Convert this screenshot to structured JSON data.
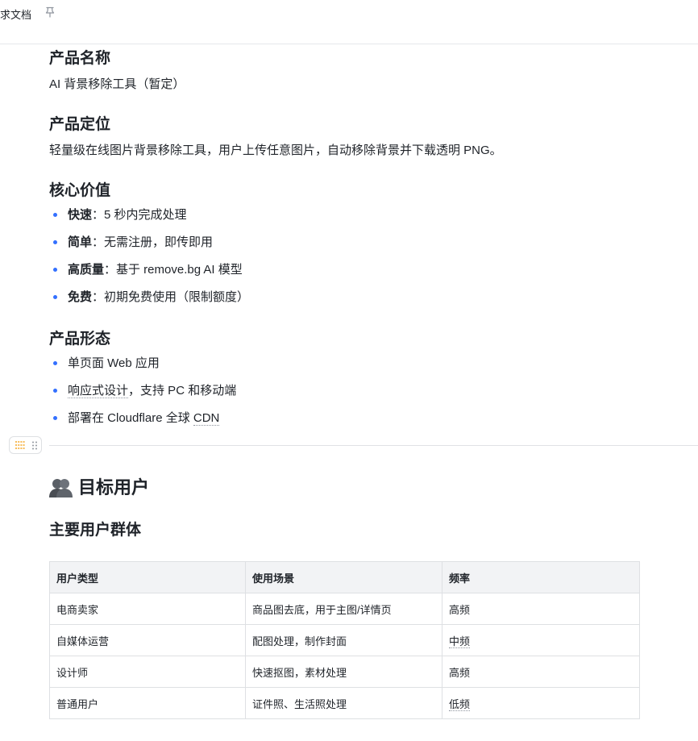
{
  "header": {
    "doc_title": "求文档"
  },
  "sections": {
    "product_name": {
      "heading": "产品名称",
      "text": "AI 背景移除工具（暂定）"
    },
    "positioning": {
      "heading": "产品定位",
      "text": "轻量级在线图片背景移除工具，用户上传任意图片，自动移除背景并下载透明 PNG。"
    },
    "core_value": {
      "heading": "核心价值",
      "items": [
        {
          "label": "快速",
          "text": "：5 秒内完成处理"
        },
        {
          "label": "简单",
          "text": "：无需注册，即传即用"
        },
        {
          "label": "高质量",
          "text": "：基于 remove.bg AI 模型"
        },
        {
          "label": "免费",
          "text": "：初期免费使用（限制额度）"
        }
      ]
    },
    "form": {
      "heading": "产品形态",
      "items": [
        {
          "text": "单页面 Web 应用"
        },
        {
          "text_a": "响应式设计",
          "text_b": "，支持 PC 和移动端"
        },
        {
          "text_a": "部署在 Cloudflare 全球 ",
          "text_b": "CDN"
        }
      ]
    }
  },
  "target_users": {
    "heading": "目标用户",
    "subheading": "主要用户群体",
    "table": {
      "columns": [
        "用户类型",
        "使用场景",
        "频率"
      ],
      "rows": [
        [
          "电商卖家",
          "商品图去底，用于主图/详情页",
          "高频"
        ],
        [
          "自媒体运营",
          "配图处理，制作封面",
          "中频"
        ],
        [
          "设计师",
          "快速抠图，素材处理",
          "高频"
        ],
        [
          "普通用户",
          "证件照、生活照处理",
          "低频"
        ]
      ]
    }
  },
  "icons": [
    "pin-icon",
    "users-icon",
    "lines-icon",
    "drag-handle-icon"
  ],
  "colors": {
    "bullet": "#3370ff",
    "block_handle_accent": "#f5a623",
    "table_header_bg": "#f2f3f5"
  }
}
